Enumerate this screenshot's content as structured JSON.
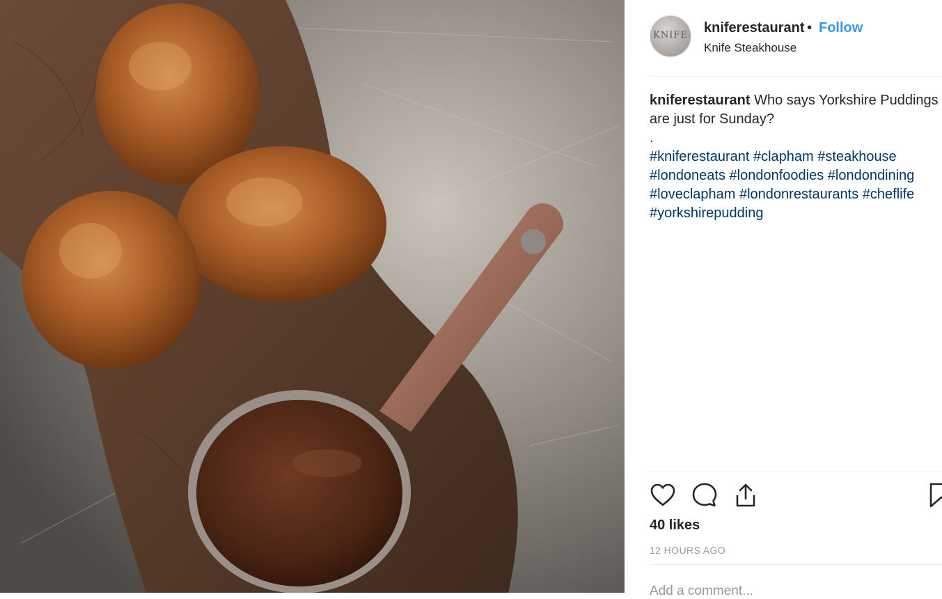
{
  "post": {
    "image_alt": "Yorkshire puddings on a wooden board with a copper pan of gravy",
    "account": {
      "username": "kniferestaurant",
      "separator": "•",
      "follow_label": "Follow",
      "location": "Knife Steakhouse",
      "avatar_text": "KNIFE"
    },
    "caption": {
      "username": "kniferestaurant",
      "text": "Who says Yorkshire Puddings are just for Sunday?",
      "dot_line": ".",
      "hashtags": [
        "#kniferestaurant",
        "#clapham",
        "#steakhouse",
        "#londoneats",
        "#londonfoodies",
        "#londondining",
        "#loveclapham",
        "#londonrestaurants",
        "#cheflife",
        "#yorkshirepudding"
      ]
    },
    "actions": {
      "icons": [
        "heart-icon",
        "comment-icon",
        "share-icon",
        "bookmark-icon"
      ]
    },
    "likes_text": "40 likes",
    "timestamp": "12 HOURS AGO",
    "comment_placeholder": "Add a comment..."
  },
  "colors": {
    "link_blue": "#3897f0",
    "hashtag_blue": "#003569",
    "text": "#262626",
    "muted": "#999999",
    "divider": "#efefef"
  }
}
